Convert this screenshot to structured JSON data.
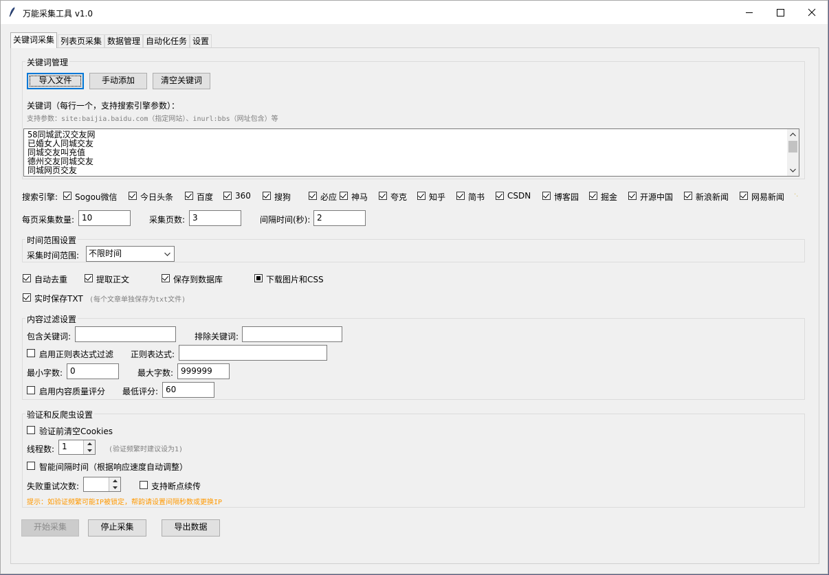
{
  "window": {
    "title": "万能采集工具 v1.0"
  },
  "tabs": [
    "关键词采集",
    "列表页采集",
    "数据管理",
    "自动化任务",
    "设置"
  ],
  "keyword_mgmt": {
    "group_title": "关键词管理",
    "import_button": "导入文件",
    "manual_add_button": "手动添加",
    "clear_button": "清空关键词",
    "label": "关键词（每行一个，支持搜索引擎参数）：",
    "hint": "支持参数：site:baijia.baidu.com（指定网站）、inurl:bbs（网址包含）等",
    "keywords": [
      "58同城武汉交友网",
      "已婚女人同城交友",
      "同城交友叫充值",
      "德州交友同城交友",
      "同城网页交友"
    ]
  },
  "engines": {
    "label": "搜索引擎:",
    "items": [
      "Sogou微信",
      "今日头条",
      "百度",
      "360",
      "搜狗",
      "必应",
      "神马",
      "夸克",
      "知乎",
      "简书",
      "CSDN",
      "博客园",
      "掘金",
      "开源中国",
      "新浪新闻",
      "网易新闻"
    ]
  },
  "params": {
    "per_page_label": "每页采集数量:",
    "per_page_value": "10",
    "pages_label": "采集页数:",
    "pages_value": "3",
    "interval_label": "间隔时间(秒):",
    "interval_value": "2"
  },
  "time_range": {
    "group_title": "时间范围设置",
    "label": "采集时间范围:",
    "selected": "不限时间"
  },
  "options": {
    "dedupe": "自动去重",
    "extract_body": "提取正文",
    "save_db": "保存到数据库",
    "download_assets": "下载图片和CSS",
    "save_txt": "实时保存TXT",
    "save_txt_hint": "(每个文章单独保存为txt文件)"
  },
  "content_filter": {
    "group_title": "内容过滤设置",
    "include_label": "包含关键词:",
    "include_value": "",
    "exclude_label": "排除关键词:",
    "exclude_value": "",
    "regex_enable": "启用正则表达式过滤",
    "regex_label": "正则表达式:",
    "regex_value": "",
    "min_chars_label": "最小字数:",
    "min_chars_value": "0",
    "max_chars_label": "最大字数:",
    "max_chars_value": "999999",
    "quality_enable": "启用内容质量评分",
    "min_score_label": "最低评分:",
    "min_score_value": "60"
  },
  "anti_crawl": {
    "group_title": "验证和反爬虫设置",
    "clear_cookies": "验证前清空Cookies",
    "threads_label": "线程数:",
    "threads_value": "1",
    "threads_hint": "(验证频繁时建议设为1)",
    "smart_interval": "智能间隔时间（根据响应速度自动调整）",
    "retries_label": "失败重试次数:",
    "retries_value": "",
    "resume": "支持断点续传",
    "warning": "提示：如验证频繁可能IP被锁定，帮韵请设置间隔秒数或更换IP"
  },
  "actions": {
    "start": "开始采集",
    "stop": "停止采集",
    "export": "导出数据"
  },
  "colors": {
    "accent": "#0078d7",
    "warning": "#ff9900",
    "hint": "#808080"
  }
}
